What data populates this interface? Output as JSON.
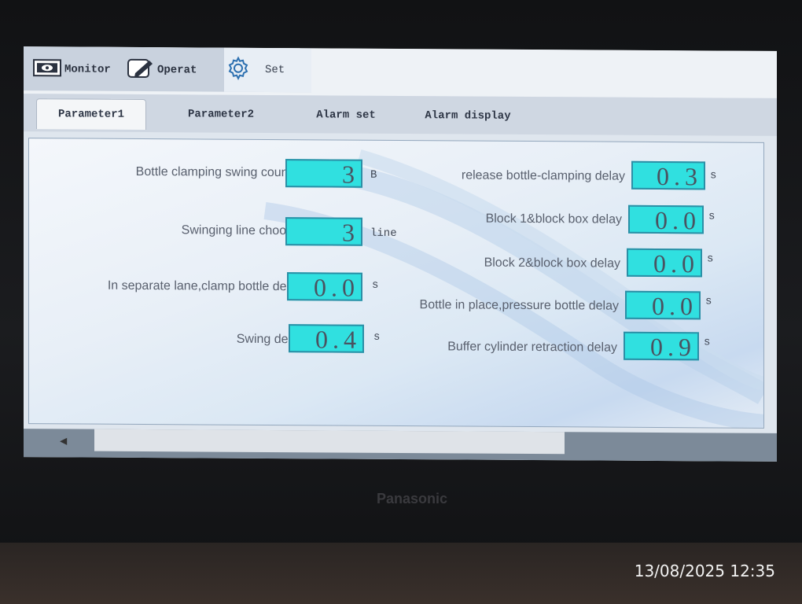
{
  "menu": {
    "monitor_label": "Monitor",
    "operat_label": "Operat",
    "set_label": "Set"
  },
  "tabs": [
    "Parameter1",
    "Parameter2",
    "Alarm set",
    "Alarm display"
  ],
  "left_params": [
    {
      "label": "Bottle clamping swing count",
      "value": "3",
      "unit": "B"
    },
    {
      "label": "Swinging line choose",
      "value": "3",
      "unit": "line"
    },
    {
      "label": "In separate lane,clamp bottle delay",
      "value": "0.0",
      "unit": "s"
    },
    {
      "label": "Swing delay",
      "value": "0.4",
      "unit": "s"
    }
  ],
  "right_params": [
    {
      "label": "release bottle-clamping delay",
      "value": "0.3",
      "unit": "s"
    },
    {
      "label": "Block 1&block box delay",
      "value": "0.0",
      "unit": "s"
    },
    {
      "label": "Block 2&block box delay",
      "value": "0.0",
      "unit": "s"
    },
    {
      "label": "Bottle in place,pressure bottle delay",
      "value": "0.0",
      "unit": "s"
    },
    {
      "label": "Buffer cylinder retraction delay",
      "value": "0.9",
      "unit": "s"
    }
  ],
  "brand": "Panasonic",
  "timestamp": "13/08/2025 12:35",
  "colors": {
    "field": "#30e0e0",
    "field_border": "#2b8fa6"
  }
}
